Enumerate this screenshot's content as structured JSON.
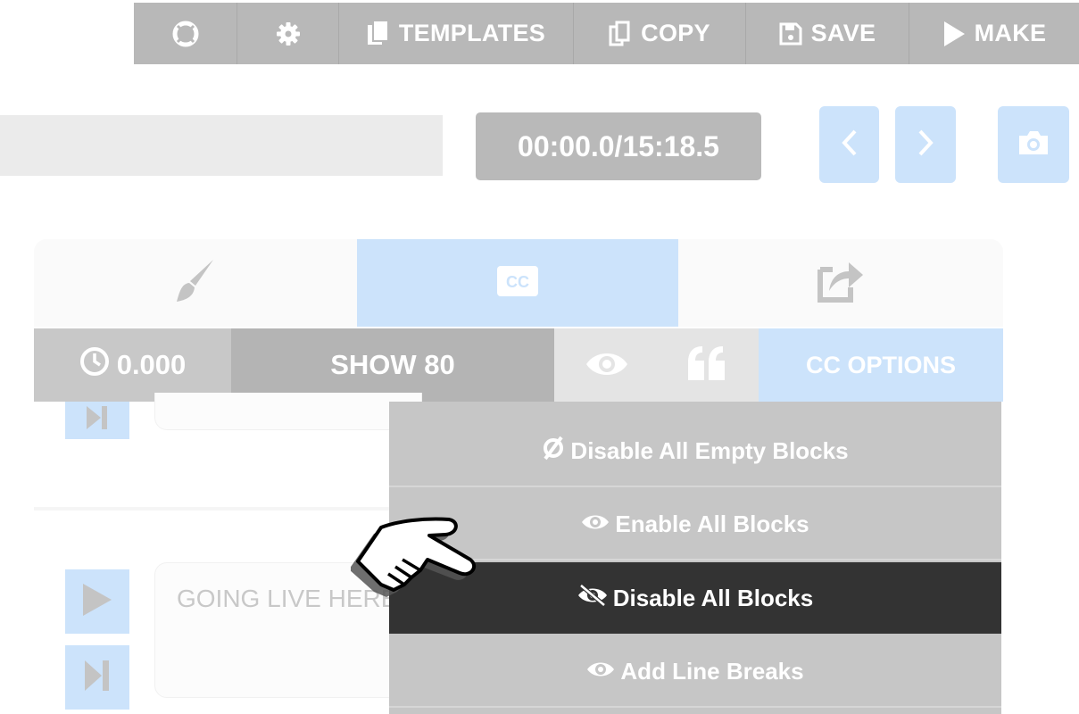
{
  "toolbar": {
    "templates_label": "TEMPLATES",
    "copy_label": "COPY",
    "save_label": "SAVE",
    "make_label": "MAKE"
  },
  "player": {
    "timecode": "00:00.0/15:18.5"
  },
  "options_bar": {
    "delay_value": "0.000",
    "show_label": "SHOW 80",
    "cc_options_label": "CC OPTIONS"
  },
  "blocks": {
    "block_text": "GOING LIVE HERE"
  },
  "dropdown": {
    "items": [
      {
        "label": "Disable All Empty Blocks"
      },
      {
        "label": "Enable All Blocks"
      },
      {
        "label": "Disable All Blocks"
      },
      {
        "label": "Add Line Breaks"
      }
    ]
  },
  "icons": {
    "toolbar": [
      "lifebuoy-icon",
      "gear-icon",
      "templates-icon",
      "copy-icon",
      "save-icon",
      "play-icon"
    ],
    "nav": [
      "chevron-left-icon",
      "chevron-right-icon",
      "camera-icon"
    ],
    "tabs": [
      "paintbrush-icon",
      "closed-caption-icon",
      "share-icon"
    ],
    "options": [
      "clock-icon",
      "eye-icon",
      "quote-icon"
    ]
  },
  "colors": {
    "toolbar_bg": "#b8b8b8",
    "accent_light_blue": "#cce3fb",
    "dropdown_bg": "#c6c6c6",
    "dropdown_active": "#333333"
  }
}
